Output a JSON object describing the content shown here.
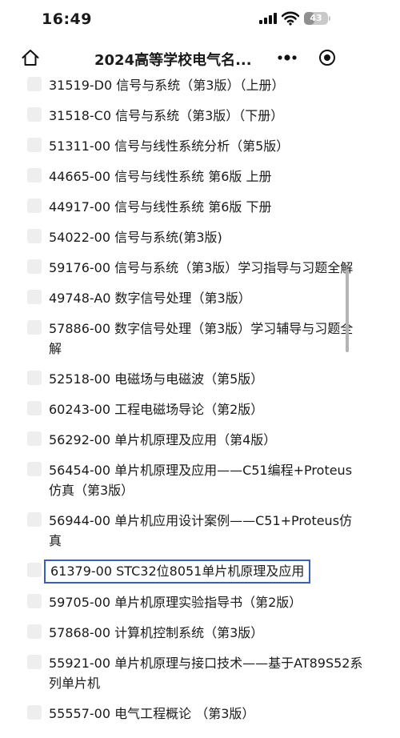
{
  "status_bar": {
    "time": "16:49",
    "battery_level": "43",
    "battery_fraction": 0.43
  },
  "nav": {
    "title": "2024高等学校电气名...",
    "icons": [
      "home-icon",
      "more-icon",
      "target-icon"
    ]
  },
  "books": [
    {
      "text": "31519-D0 信号与系统（第3版）（上册）"
    },
    {
      "text": "31518-C0 信号与系统（第3版）（下册）"
    },
    {
      "text": "51311-00 信号与线性系统分析（第5版）"
    },
    {
      "text": "44665-00 信号与线性系统 第6版 上册"
    },
    {
      "text": "44917-00 信号与线性系统 第6版 下册"
    },
    {
      "text": "54022-00 信号与系统(第3版)"
    },
    {
      "text": "59176-00 信号与系统（第3版）学习指导与习题全解"
    },
    {
      "text": "49748-A0 数字信号处理（第3版）"
    },
    {
      "text": "57886-00 数字信号处理（第3版）学习辅导与习题全解"
    },
    {
      "text": "52518-00 电磁场与电磁波（第5版）"
    },
    {
      "text": "60243-00 工程电磁场导论（第2版）"
    },
    {
      "text": "56292-00 单片机原理及应用（第4版）"
    },
    {
      "text": "56454-00 单片机原理及应用——C51编程+Proteus仿真（第3版）"
    },
    {
      "text": "56944-00 单片机应用设计案例——C51+Proteus仿真"
    },
    {
      "text": "61379-00 STC32位8051单片机原理及应用",
      "highlighted": true
    },
    {
      "text": "59705-00 单片机原理实验指导书（第2版）"
    },
    {
      "text": "57868-00 计算机控制系统（第3版）"
    },
    {
      "text": "55921-00 单片机原理与接口技术——基于AT89S52系列单片机"
    },
    {
      "text": "55557-00 电气工程概论 （第3版）"
    }
  ],
  "colors": {
    "highlight_border": "#3a5ec0",
    "checkbox": "#eeeeee",
    "text": "#1a1a1a"
  }
}
